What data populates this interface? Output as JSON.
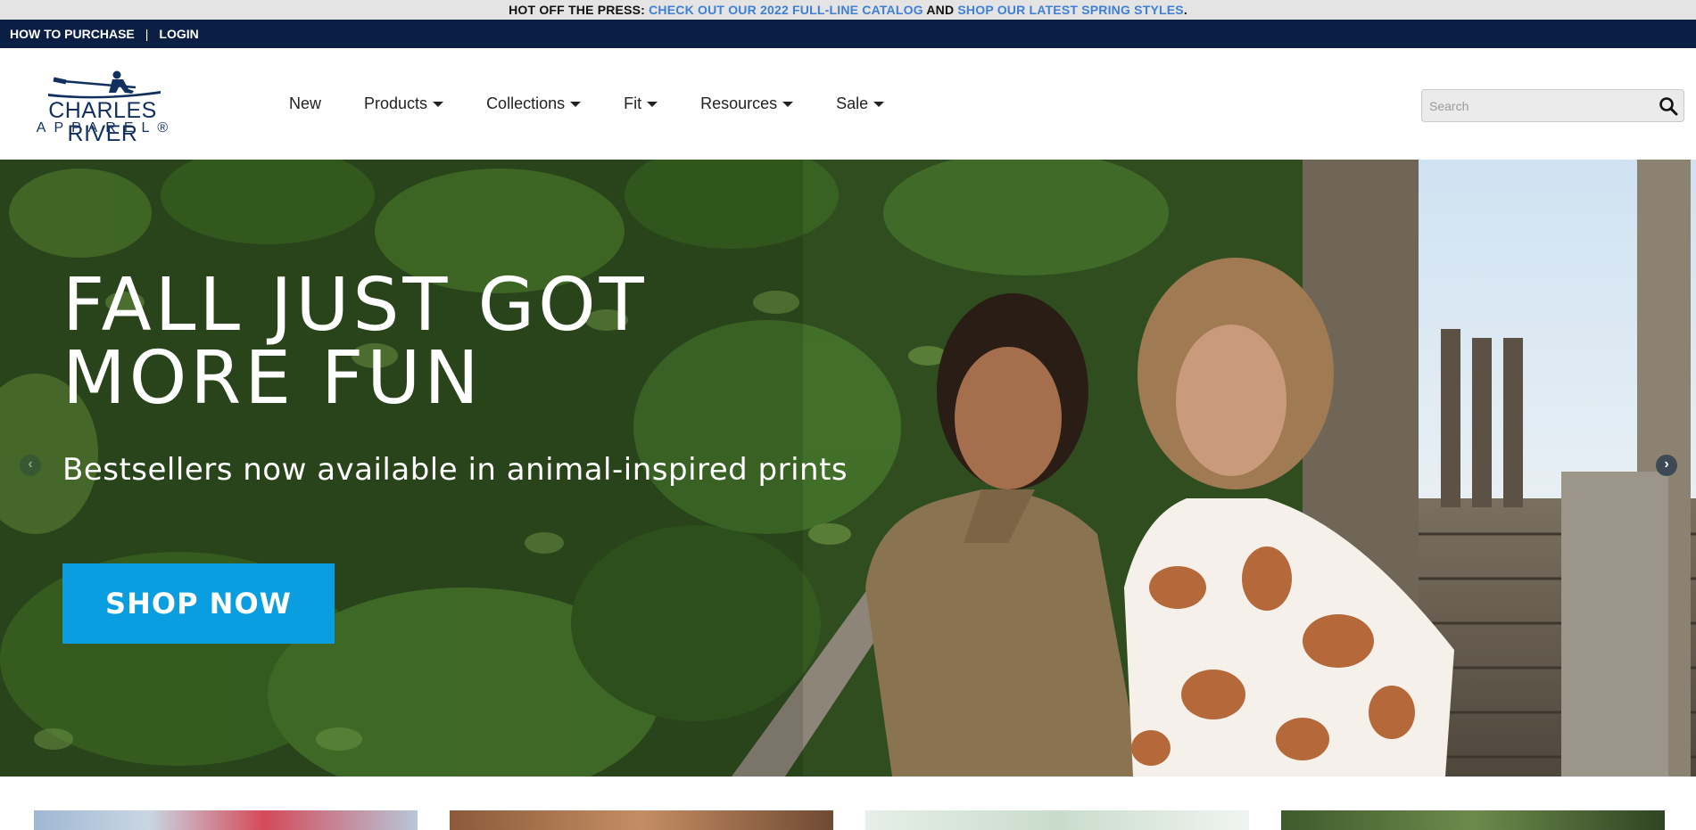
{
  "announcement": {
    "prefix": "HOT OFF THE PRESS: ",
    "link1": "CHECK OUT OUR 2022 FULL-LINE CATALOG",
    "middle": " AND ",
    "link2": "SHOP OUR LATEST SPRING STYLES",
    "suffix": "."
  },
  "utility": {
    "how_to_purchase": "HOW TO PURCHASE",
    "separator": "|",
    "login": "LOGIN"
  },
  "logo": {
    "line1": "CHARLES RIVER",
    "line2": "APPAREL®"
  },
  "nav": {
    "items": [
      {
        "label": "New"
      },
      {
        "label": "Products"
      },
      {
        "label": "Collections"
      },
      {
        "label": "Fit"
      },
      {
        "label": "Resources"
      },
      {
        "label": "Sale"
      }
    ]
  },
  "search": {
    "placeholder": "Search"
  },
  "hero": {
    "title": "FALL JUST GOT\nMORE FUN",
    "subtitle": "Bestsellers now available in animal-inspired prints",
    "cta": "SHOP NOW",
    "prev_arrow": "‹",
    "next_arrow": "›"
  },
  "colors": {
    "navy": "#0b1f45",
    "link_blue": "#3f7fd4",
    "cta_blue": "#0a9ddf",
    "logo_blue": "#12305f"
  }
}
